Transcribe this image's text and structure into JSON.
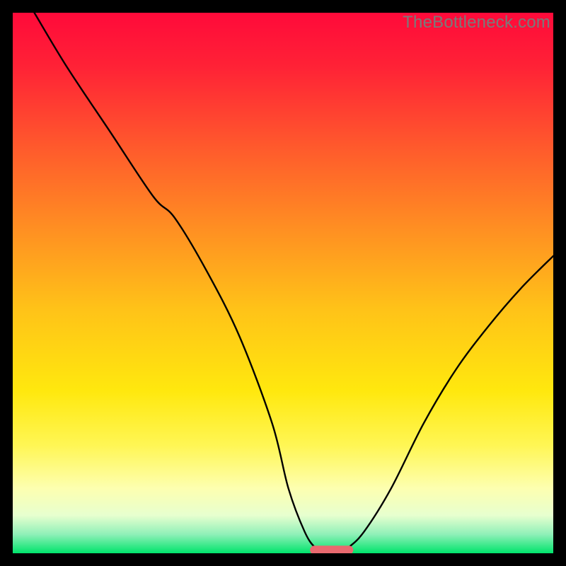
{
  "watermark": "TheBottleneck.com",
  "chart_data": {
    "type": "line",
    "title": "",
    "xlabel": "",
    "ylabel": "",
    "xlim": [
      0,
      100
    ],
    "ylim": [
      0,
      100
    ],
    "background_gradient": {
      "stops": [
        {
          "offset": 0.0,
          "color": "#ff0a3a"
        },
        {
          "offset": 0.1,
          "color": "#ff2236"
        },
        {
          "offset": 0.25,
          "color": "#ff5a2c"
        },
        {
          "offset": 0.4,
          "color": "#ff8f22"
        },
        {
          "offset": 0.55,
          "color": "#ffc318"
        },
        {
          "offset": 0.7,
          "color": "#ffe80e"
        },
        {
          "offset": 0.8,
          "color": "#fff654"
        },
        {
          "offset": 0.88,
          "color": "#fdffb0"
        },
        {
          "offset": 0.93,
          "color": "#e7ffcf"
        },
        {
          "offset": 0.965,
          "color": "#8ff0b8"
        },
        {
          "offset": 1.0,
          "color": "#00e46b"
        }
      ]
    },
    "series": [
      {
        "name": "bottleneck-curve",
        "x": [
          4,
          10,
          18,
          26,
          30,
          36,
          42,
          48,
          51,
          54,
          56,
          58,
          60,
          62,
          65,
          70,
          76,
          82,
          88,
          94,
          100
        ],
        "y": [
          100,
          90,
          78,
          66,
          62,
          52,
          40,
          24,
          12,
          4,
          1,
          0,
          0,
          1,
          4,
          12,
          24,
          34,
          42,
          49,
          55
        ]
      }
    ],
    "marker": {
      "name": "optimal-zone",
      "shape": "capsule",
      "color": "#e96a6f",
      "cx": 59,
      "cy": 0.6,
      "w": 8,
      "h": 1.6
    }
  }
}
